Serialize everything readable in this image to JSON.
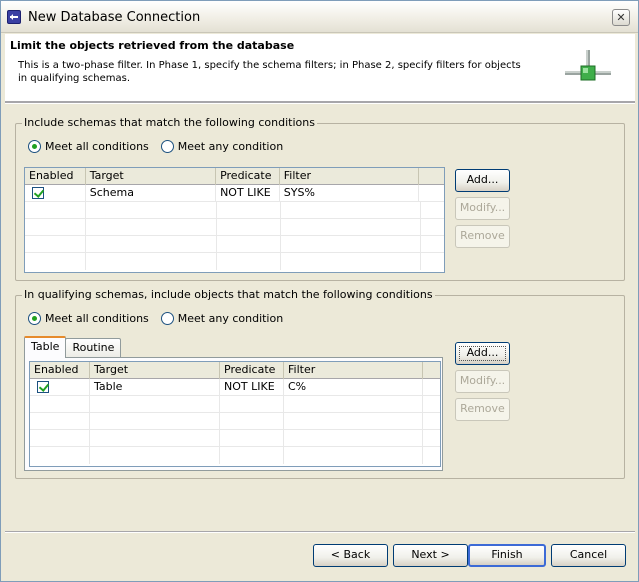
{
  "window": {
    "title": "New Database Connection",
    "close_glyph": "✕"
  },
  "header": {
    "title": "Limit the objects retrieved from the database",
    "description": "This is a two-phase filter. In Phase 1, specify the schema filters; in Phase 2, specify filters for objects in qualifying schemas.",
    "graphic": "database-pipe-graphic"
  },
  "schema_group": {
    "label": "Include schemas that match the following conditions",
    "radio_all": "Meet all conditions",
    "radio_any": "Meet any condition",
    "selected": "all",
    "columns": [
      "Enabled",
      "Target",
      "Predicate",
      "Filter"
    ],
    "rows": [
      {
        "enabled": true,
        "target": "Schema",
        "predicate": "NOT LIKE",
        "filter": "SYS%"
      }
    ],
    "buttons": {
      "add": "Add...",
      "modify": "Modify...",
      "remove": "Remove"
    }
  },
  "object_group": {
    "label": "In qualifying schemas, include objects that match the following conditions",
    "radio_all": "Meet all conditions",
    "radio_any": "Meet any condition",
    "selected": "all",
    "tabs": [
      "Table",
      "Routine"
    ],
    "active_tab": "Table",
    "columns": [
      "Enabled",
      "Target",
      "Predicate",
      "Filter"
    ],
    "rows": [
      {
        "enabled": true,
        "target": "Table",
        "predicate": "NOT LIKE",
        "filter": "C%"
      }
    ],
    "buttons": {
      "add": "Add...",
      "modify": "Modify...",
      "remove": "Remove"
    }
  },
  "footer": {
    "back": "< Back",
    "next": "Next >",
    "finish": "Finish",
    "cancel": "Cancel"
  },
  "colors": {
    "check_accent": "#21a121",
    "tab_accent": "#e68b2c",
    "default_button_border": "#3c6ad6"
  }
}
